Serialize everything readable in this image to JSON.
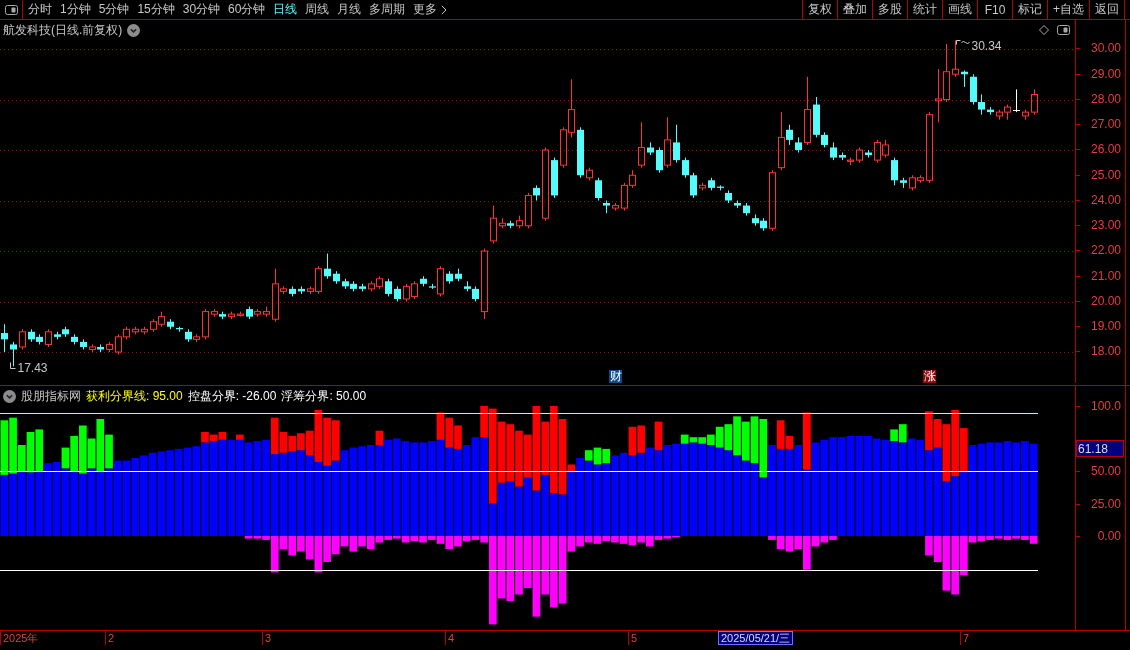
{
  "toolbar": {
    "periods": [
      {
        "label": "分时",
        "kind": "period",
        "selected": false
      },
      {
        "label": "1分钟",
        "kind": "period",
        "selected": false
      },
      {
        "label": "5分钟",
        "kind": "period",
        "selected": false
      },
      {
        "label": "15分钟",
        "kind": "period",
        "selected": false
      },
      {
        "label": "30分钟",
        "kind": "period",
        "selected": false
      },
      {
        "label": "60分钟",
        "kind": "period",
        "selected": false
      },
      {
        "label": "日线",
        "kind": "period",
        "selected": true
      },
      {
        "label": "周线",
        "kind": "period",
        "selected": false
      },
      {
        "label": "月线",
        "kind": "period",
        "selected": false
      },
      {
        "label": "多周期",
        "kind": "period",
        "selected": false
      },
      {
        "label": "更多",
        "kind": "menu",
        "selected": false
      }
    ],
    "actions": [
      "复权",
      "叠加",
      "多股",
      "统计",
      "画线",
      "F10",
      "标记",
      "+自选",
      "返回"
    ]
  },
  "price_panel": {
    "title": "航发科技(日线.前复权)",
    "axis_labels": [
      "30.00",
      "29.00",
      "28.00",
      "27.00",
      "26.00",
      "25.00",
      "24.00",
      "23.00",
      "22.00",
      "21.00",
      "20.00",
      "19.00",
      "18.00"
    ],
    "high_label": "30.34",
    "low_label": "17.43",
    "event_markers": [
      {
        "label": "财",
        "color": "#0c4a8a"
      },
      {
        "label": "涨",
        "color": "#8c0a0a"
      }
    ]
  },
  "indicator_panel": {
    "name": "股朋指标网",
    "params": [
      {
        "label": "获利分界线:",
        "value": "95.00",
        "color": "#ffff00"
      },
      {
        "label": "控盘分界:",
        "value": "-26.00",
        "color": "#ffffff"
      },
      {
        "label": "浮筹分界:",
        "value": "50.00",
        "color": "#ffffff"
      }
    ],
    "chart_data": {
      "type": "bar",
      "stacked": true,
      "ylim": [
        -72.69,
        115.77
      ],
      "yticks": [
        {
          "value": 0,
          "label": "0.00"
        },
        {
          "value": 25,
          "label": "25.00"
        },
        {
          "value": 50,
          "label": "50.00"
        },
        {
          "value": 100,
          "label": "100.0"
        }
      ],
      "series": [
        {
          "color": "#0000ff",
          "values": [
            47,
            48,
            50,
            49,
            50,
            56,
            57,
            52,
            50,
            48,
            52,
            50,
            52,
            58,
            58,
            60,
            62,
            64,
            65,
            66,
            67,
            68,
            69,
            72,
            73,
            74,
            74,
            74,
            72,
            73,
            74,
            63,
            64,
            65,
            66,
            62,
            57,
            54,
            58,
            66,
            68,
            69,
            70,
            70,
            74,
            75,
            73,
            72,
            72,
            73,
            74,
            68,
            67,
            70,
            76,
            76,
            25,
            41,
            42,
            38,
            45,
            35,
            47,
            33,
            32,
            50,
            60,
            58,
            55,
            56,
            62,
            64,
            62,
            64,
            68,
            66,
            70,
            71,
            71,
            72,
            71,
            70,
            68,
            66,
            62,
            58,
            56,
            45,
            70,
            67,
            67,
            70,
            51,
            72,
            74,
            76,
            76,
            77,
            77,
            77,
            75,
            74,
            73,
            72,
            75,
            74,
            66,
            68,
            42,
            46,
            50,
            70,
            71,
            72,
            72,
            73,
            72,
            73,
            71
          ]
        },
        {
          "color": "#ff0000",
          "values": [
            0,
            0,
            0,
            0,
            0,
            0,
            0,
            0,
            0,
            0,
            0,
            0,
            0,
            0,
            0,
            0,
            0,
            0,
            0,
            0,
            0,
            0,
            0,
            8,
            5,
            6,
            0,
            4,
            0,
            0,
            0,
            28,
            16,
            12,
            13,
            19,
            40,
            37,
            31,
            0,
            0,
            0,
            0,
            11,
            0,
            0,
            0,
            0,
            0,
            0,
            21,
            23,
            18,
            0,
            0,
            24,
            73,
            47,
            44,
            43,
            33,
            65,
            41,
            67,
            58,
            5,
            0,
            0,
            0,
            0,
            0,
            0,
            22,
            21,
            0,
            22,
            0,
            0,
            0,
            0,
            0,
            0,
            0,
            0,
            0,
            0,
            0,
            0,
            0,
            22,
            10,
            0,
            44,
            0,
            0,
            0,
            0,
            0,
            0,
            0,
            0,
            0,
            0,
            0,
            0,
            0,
            30,
            22,
            44,
            51,
            33,
            0,
            0,
            0,
            0,
            0,
            0,
            0,
            0
          ]
        },
        {
          "color": "#00ff00",
          "values": [
            42,
            43,
            20,
            31,
            32,
            0,
            0,
            16,
            27,
            37,
            23,
            40,
            26,
            0,
            0,
            0,
            0,
            0,
            0,
            0,
            0,
            0,
            0,
            0,
            0,
            0,
            0,
            0,
            0,
            0,
            0,
            0,
            0,
            0,
            0,
            0,
            0,
            0,
            0,
            0,
            0,
            0,
            0,
            0,
            0,
            0,
            0,
            0,
            0,
            0,
            0,
            0,
            0,
            0,
            0,
            0,
            0,
            0,
            0,
            0,
            0,
            0,
            0,
            0,
            0,
            0,
            0,
            8,
            13,
            11,
            0,
            0,
            0,
            0,
            0,
            0,
            0,
            0,
            7,
            4,
            5,
            8,
            16,
            20,
            30,
            30,
            36,
            45,
            0,
            0,
            0,
            0,
            0,
            0,
            0,
            0,
            0,
            0,
            0,
            0,
            0,
            0,
            9,
            14,
            0,
            0,
            0,
            0,
            0,
            0,
            0,
            0,
            0,
            0,
            0,
            0,
            0,
            0,
            0
          ]
        },
        {
          "color": "#ff00ff",
          "values": [
            0,
            0,
            0,
            0,
            0,
            0,
            0,
            0,
            0,
            0,
            0,
            0,
            0,
            0,
            0,
            0,
            0,
            0,
            0,
            0,
            0,
            0,
            0,
            0,
            0,
            0,
            0,
            0,
            -2,
            -2,
            -3,
            -28,
            -10,
            -15,
            -12,
            -18,
            -28,
            -20,
            -14,
            -8,
            -12,
            -8,
            -10,
            -5,
            -3,
            -2,
            -5,
            -4,
            -5,
            -3,
            -6,
            -10,
            -8,
            -4,
            -3,
            -5,
            -68,
            -48,
            -50,
            -45,
            -40,
            -62,
            -45,
            -55,
            -52,
            -12,
            -8,
            -5,
            -6,
            -4,
            -5,
            -6,
            -7,
            -5,
            -8,
            -3,
            -2,
            -1,
            0,
            0,
            0,
            0,
            0,
            0,
            0,
            0,
            0,
            0,
            -3,
            -10,
            -12,
            -10,
            -26,
            -8,
            -5,
            -3,
            0,
            0,
            0,
            0,
            0,
            0,
            0,
            0,
            0,
            0,
            -15,
            -20,
            -42,
            -45,
            -30,
            -5,
            -4,
            -3,
            -2,
            -3,
            -2,
            -3,
            -6
          ]
        }
      ],
      "ref_lines": [
        {
          "axis": "y",
          "value": 95,
          "color": "#ffff00"
        },
        {
          "axis": "y",
          "value": 50,
          "color": "#ffffff"
        },
        {
          "axis": "y",
          "value": -26,
          "color": "#ffffff"
        }
      ],
      "annotations": [
        "61.18"
      ]
    }
  },
  "date_axis": {
    "labels": [
      "2025年",
      "2",
      "3",
      "4",
      "5",
      "7"
    ],
    "cursor": "2025/05/21/三"
  }
}
